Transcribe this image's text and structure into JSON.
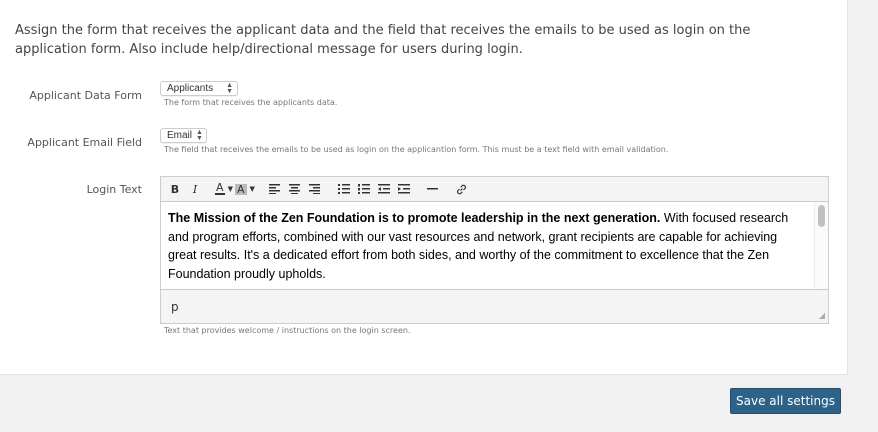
{
  "intro": "Assign the form that receives the applicant data and the field that receives the emails to be used as login on the application form. Also include help/directional message for users during login.",
  "applicant_form": {
    "label": "Applicant Data Form",
    "selected": "Applicants",
    "help": "The form that receives the applicants data."
  },
  "applicant_email": {
    "label": "Applicant Email Field",
    "selected": "Email",
    "help": "The field that receives the emails to be used as login on the applicantion form. This must be a text field with email validation."
  },
  "login_text": {
    "label": "Login Text",
    "bold_part": "The Mission of the Zen Foundation is to promote leadership in the next generation.",
    "rest": " With focused research and program efforts, combined with our vast resources and network, grant recipients are capable for achieving great results. It's a dedicated effort from both sides, and worthy of the commitment to excellence that the Zen Foundation proudly upholds.",
    "path": "p",
    "help": "Text that provides welcome / instructions on the login screen."
  },
  "toolbar": {
    "bold": "B",
    "italic": "I",
    "font_color": "A",
    "bg_color": "A"
  },
  "save_label": "Save all settings"
}
